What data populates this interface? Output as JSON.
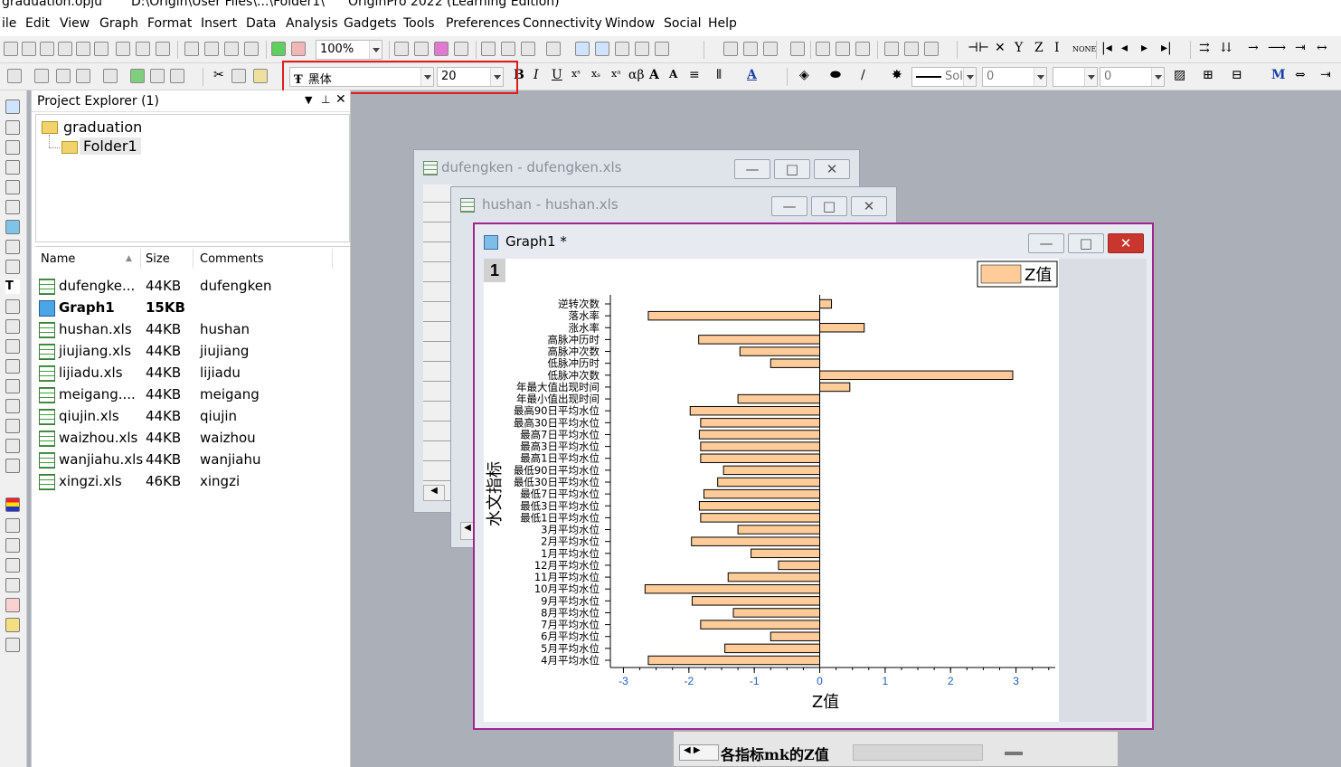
{
  "app": {
    "title_file": "graduation.opju",
    "title_path": "D:\\Origin\\User Files\\...\\Folder1\\",
    "title_app": "OriginPro 2022 (Learning Edition)"
  },
  "menu": [
    "ile",
    "Edit",
    "View",
    "Graph",
    "Format",
    "Insert",
    "Data",
    "Analysis",
    "Gadgets",
    "Tools",
    "Preferences",
    "Connectivity",
    "Window",
    "Social",
    "Help"
  ],
  "toolbar": {
    "zoom_value": "100%",
    "font_name": "黑体",
    "font_size": "20",
    "line_style": "Sol",
    "line_width": "0",
    "fill_value": "0"
  },
  "project_explorer": {
    "title": "Project Explorer (1)",
    "tree": [
      "graduation",
      "Folder1"
    ],
    "columns": [
      "Name",
      "Size",
      "Comments"
    ],
    "rows": [
      {
        "name": "dufengke...",
        "size": "44KB",
        "comment": "dufengken",
        "type": "book"
      },
      {
        "name": "Graph1",
        "size": "15KB",
        "comment": "",
        "type": "graph"
      },
      {
        "name": "hushan.xls",
        "size": "44KB",
        "comment": "hushan",
        "type": "book"
      },
      {
        "name": "jiujiang.xls",
        "size": "44KB",
        "comment": "jiujiang",
        "type": "book"
      },
      {
        "name": "lijiadu.xls",
        "size": "44KB",
        "comment": "lijiadu",
        "type": "book"
      },
      {
        "name": "meigang....",
        "size": "44KB",
        "comment": "meigang",
        "type": "book"
      },
      {
        "name": "qiujin.xls",
        "size": "44KB",
        "comment": "qiujin",
        "type": "book"
      },
      {
        "name": "waizhou.xls",
        "size": "44KB",
        "comment": "waizhou",
        "type": "book"
      },
      {
        "name": "wanjiahu.xls",
        "size": "44KB",
        "comment": "wanjiahu",
        "type": "book"
      },
      {
        "name": "xingzi.xls",
        "size": "46KB",
        "comment": "xingzi",
        "type": "book"
      }
    ]
  },
  "windows": {
    "dufengken": "dufengken - dufengken.xls",
    "hushan": "hushan - hushan.xls",
    "graph": "Graph1 *",
    "layer": "1",
    "sheet_tab": "各指标mk的Z值"
  },
  "colors": {
    "bar_fill": "#ffcc99",
    "axis_tick_label": "#1c5fbf",
    "graph_border": "#a0258f"
  },
  "chart_data": {
    "type": "bar",
    "orientation": "horizontal",
    "xlabel": "Z值",
    "ylabel": "水文指标",
    "legend": [
      "Z值"
    ],
    "legend_position": "top-right",
    "xlim": [
      -3.2,
      3.6
    ],
    "xticks": [
      -3,
      -2,
      -1,
      0,
      1,
      2,
      3
    ],
    "categories": [
      "逆转次数",
      "落水率",
      "涨水率",
      "高脉冲历时",
      "高脉冲次数",
      "低脉冲历时",
      "低脉冲次数",
      "年最大值出现时间",
      "年最小值出现时间",
      "最高90日平均水位",
      "最高30日平均水位",
      "最高7日平均水位",
      "最高3日平均水位",
      "最高1日平均水位",
      "最低90日平均水位",
      "最低30日平均水位",
      "最低7日平均水位",
      "最低3日平均水位",
      "最低1日平均水位",
      "3月平均水位",
      "2月平均水位",
      "1月平均水位",
      "12月平均水位",
      "11月平均水位",
      "10月平均水位",
      "9月平均水位",
      "8月平均水位",
      "7月平均水位",
      "6月平均水位",
      "5月平均水位",
      "4月平均水位"
    ],
    "values": [
      0.18,
      -2.62,
      0.68,
      -1.85,
      -1.22,
      -0.75,
      2.95,
      0.46,
      -1.25,
      -1.98,
      -1.82,
      -1.84,
      -1.82,
      -1.82,
      -1.47,
      -1.56,
      -1.77,
      -1.84,
      -1.82,
      -1.25,
      -1.96,
      -1.05,
      -0.63,
      -1.4,
      -2.67,
      -1.95,
      -1.32,
      -1.82,
      -0.75,
      -1.45,
      -2.62
    ]
  }
}
